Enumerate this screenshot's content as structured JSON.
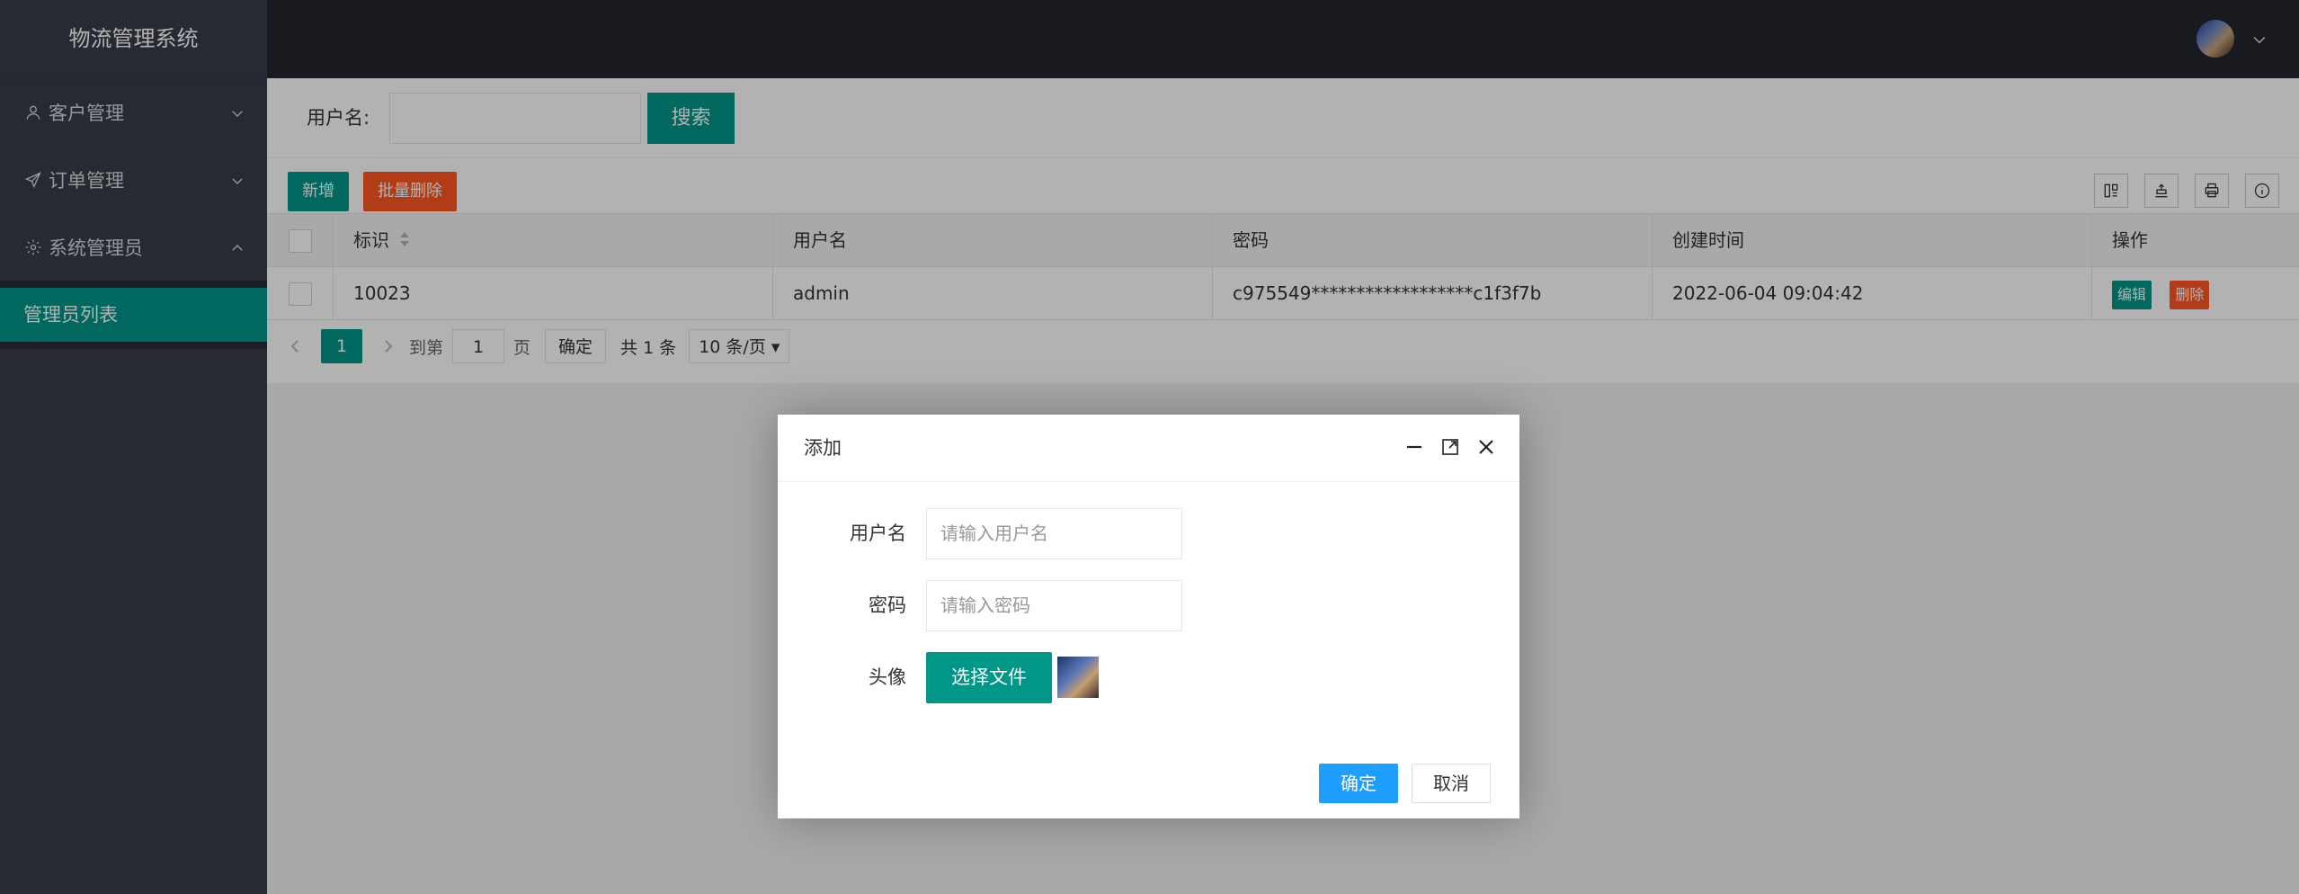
{
  "app": {
    "title": "物流管理系统"
  },
  "sidebar": {
    "items": [
      {
        "label": "客户管理",
        "icon": "user-icon",
        "expanded": false
      },
      {
        "label": "订单管理",
        "icon": "send-icon",
        "expanded": false
      },
      {
        "label": "系统管理员",
        "icon": "gear-icon",
        "expanded": true
      }
    ],
    "subitems": [
      {
        "label": "管理员列表",
        "active": true
      }
    ]
  },
  "search": {
    "label": "用户名:",
    "value": "",
    "button": "搜索"
  },
  "toolbar": {
    "add": "新增",
    "batch_delete": "批量删除"
  },
  "table": {
    "headers": [
      "标识",
      "用户名",
      "密码",
      "创建时间",
      "操作"
    ],
    "rows": [
      {
        "id": "10023",
        "username": "admin",
        "password": "c975549******************c1f3f7b",
        "created": "2022-06-04 09:04:42",
        "edit": "编辑",
        "delete": "删除"
      }
    ]
  },
  "pager": {
    "current": "1",
    "goto_label": "到第",
    "page_value": "1",
    "page_unit": "页",
    "confirm": "确定",
    "total": "共 1 条",
    "page_size": "10 条/页"
  },
  "dialog": {
    "title": "添加",
    "fields": [
      {
        "label": "用户名",
        "placeholder": "请输入用户名"
      },
      {
        "label": "密码",
        "placeholder": "请输入密码"
      }
    ],
    "avatar_label": "头像",
    "file_button": "选择文件",
    "ok": "确定",
    "cancel": "取消"
  },
  "colors": {
    "primary": "#009688",
    "danger": "#ff5722",
    "blue": "#1e9fff",
    "sidebar": "#393d49",
    "header": "#23262e"
  }
}
